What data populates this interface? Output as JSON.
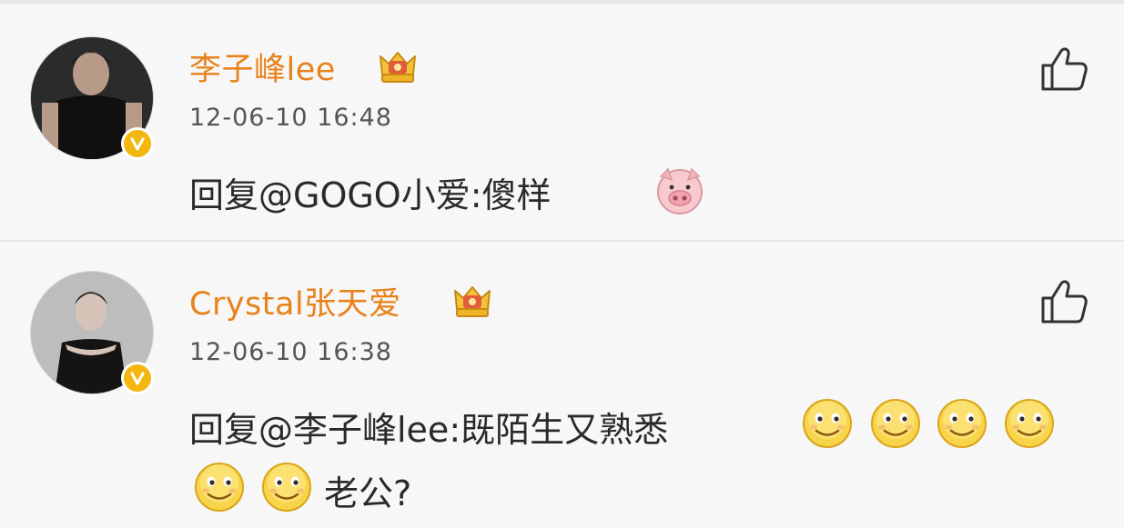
{
  "comments": [
    {
      "username": "李子峰lee",
      "timestamp": "12-06-10 16:48",
      "text": "回复@GOGO小爱:傻样",
      "avatar_icon": "avatar-photo",
      "badge_icon": "verified-v-icon",
      "member_icon": "crown-icon",
      "emoji_icons": [
        "pig-emoji"
      ]
    },
    {
      "username": "Crystal张天爱",
      "timestamp": "12-06-10 16:38",
      "text": "回复@李子峰lee:既陌生又熟悉",
      "text_continued": "老公?",
      "avatar_icon": "avatar-photo",
      "badge_icon": "verified-v-icon",
      "member_icon": "crown-icon",
      "emoji_icons": [
        "smile-emoji",
        "smile-emoji",
        "smile-emoji",
        "smile-emoji",
        "smile-emoji",
        "smile-emoji"
      ]
    }
  ],
  "colors": {
    "username": "#e9821a",
    "background": "#f7f7f7",
    "badge": "#f3b70f",
    "text": "#2a2a2a",
    "timestamp": "#555555"
  }
}
